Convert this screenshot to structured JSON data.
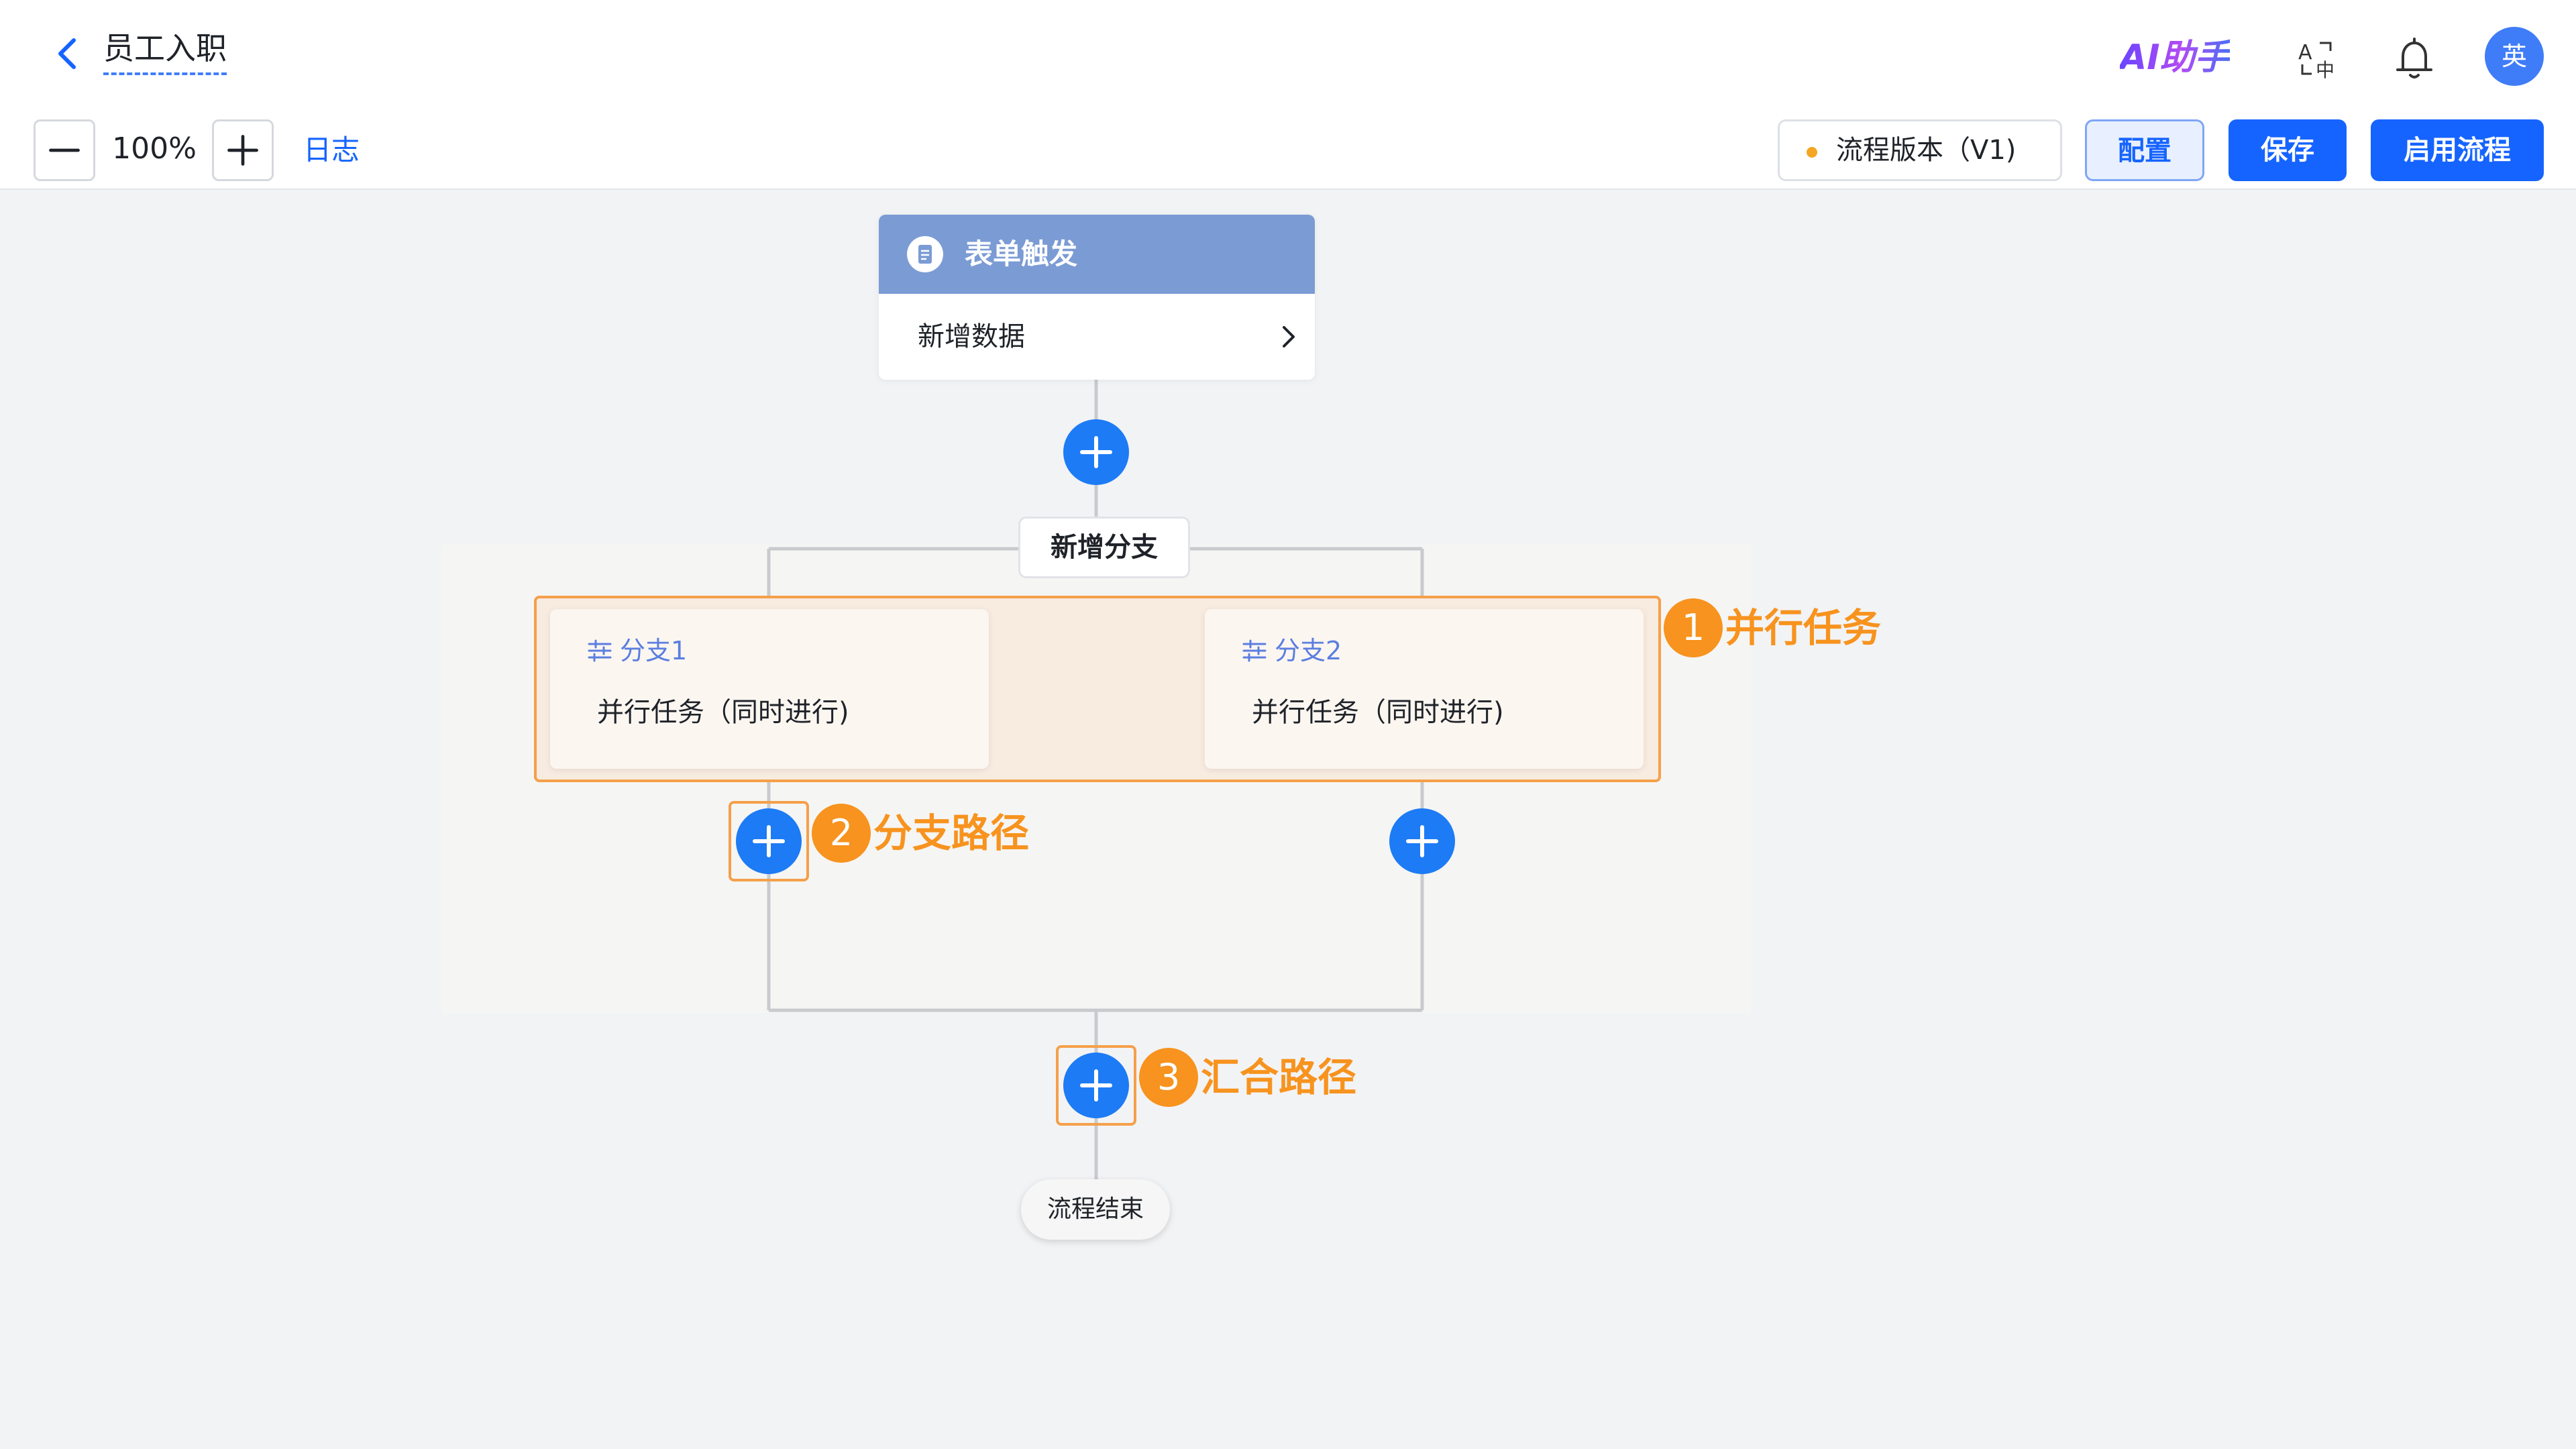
{
  "header": {
    "title": "员工入职",
    "ai_assistant": "AI助手",
    "avatar_text": "英"
  },
  "toolbar": {
    "zoom_level": "100%",
    "log_label": "日志",
    "version_label": "流程版本（V1)",
    "config_label": "配置",
    "save_label": "保存",
    "enable_label": "启用流程"
  },
  "flow": {
    "trigger": {
      "title": "表单触发",
      "event": "新增数据"
    },
    "add_branch_label": "新增分支",
    "branches": [
      {
        "name": "分支1",
        "description": "并行任务（同时进行)"
      },
      {
        "name": "分支2",
        "description": "并行任务（同时进行)"
      }
    ],
    "end_label": "流程结束"
  },
  "annotations": [
    {
      "number": "1",
      "label": "并行任务"
    },
    {
      "number": "2",
      "label": "分支路径"
    },
    {
      "number": "3",
      "label": "汇合路径"
    }
  ],
  "colors": {
    "primary": "#1664ff",
    "add_circle": "#1d7bf5",
    "trigger_header": "#7b9bd4",
    "annotation": "#f7931e"
  }
}
